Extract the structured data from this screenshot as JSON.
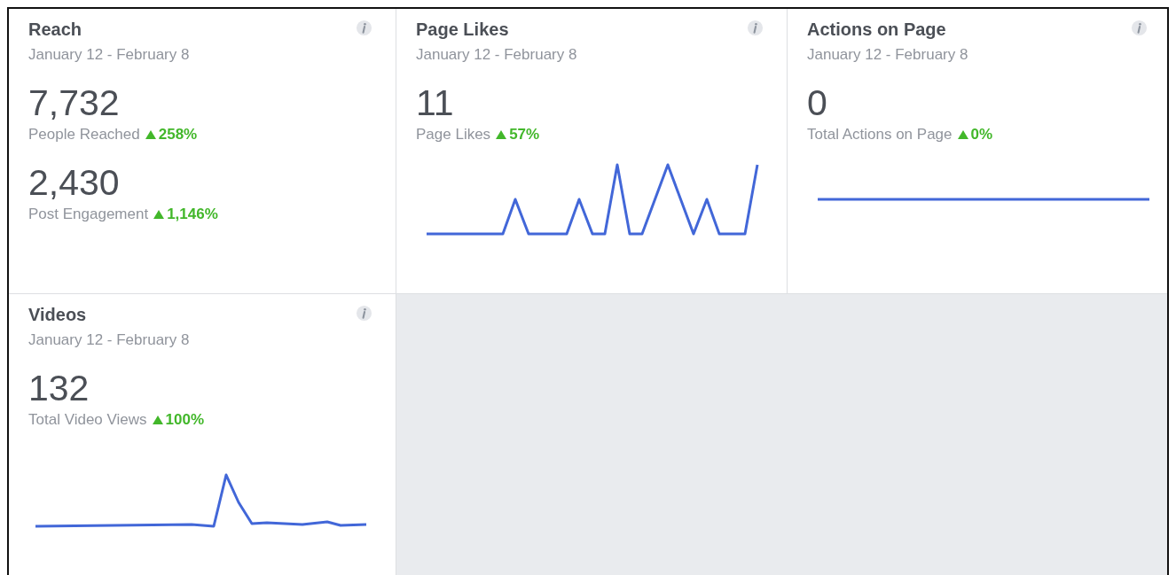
{
  "cards": [
    {
      "title": "Reach",
      "date_range": "January 12 - February 8",
      "metrics": [
        {
          "value": "7,732",
          "label": "People Reached",
          "change": "258%"
        },
        {
          "value": "2,430",
          "label": "Post Engagement",
          "change": "1,146%"
        }
      ]
    },
    {
      "title": "Page Likes",
      "date_range": "January 12 - February 8",
      "metrics": [
        {
          "value": "11",
          "label": "Page Likes",
          "change": "57%"
        }
      ]
    },
    {
      "title": "Actions on Page",
      "date_range": "January 12 - February 8",
      "metrics": [
        {
          "value": "0",
          "label": "Total Actions on Page",
          "change": "0%"
        }
      ]
    },
    {
      "title": "Videos",
      "date_range": "January 12 - February 8",
      "metrics": [
        {
          "value": "132",
          "label": "Total Video Views",
          "change": "100%"
        }
      ]
    }
  ]
}
